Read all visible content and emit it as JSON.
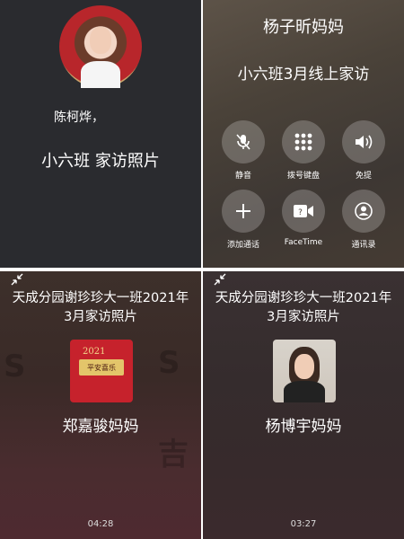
{
  "panel_top_left": {
    "caller_name": "陈柯烨，",
    "subtitle": "小六班 家访照片"
  },
  "panel_top_right": {
    "contact_name": "杨子昕妈妈",
    "call_subtitle": "小六班3月线上家访",
    "controls": [
      {
        "label": "静音",
        "icon": "mute-mic-icon"
      },
      {
        "label": "拨号键盘",
        "icon": "keypad-icon"
      },
      {
        "label": "免提",
        "icon": "speaker-icon"
      },
      {
        "label": "添加通话",
        "icon": "add-call-icon"
      },
      {
        "label": "FaceTime",
        "icon": "facetime-icon"
      },
      {
        "label": "通讯录",
        "icon": "contacts-icon"
      }
    ]
  },
  "panel_bottom_left": {
    "title": "天成分园谢珍珍大一班2021年3月家访照片",
    "thumb_year": "2021",
    "thumb_text": "平安喜乐",
    "contact_name": "郑嘉骏妈妈",
    "timer": "04:28"
  },
  "panel_bottom_right": {
    "title": "天成分园谢珍珍大一班2021年3月家访照片",
    "contact_name": "杨博宇妈妈",
    "timer": "03:27"
  },
  "colors": {
    "dark_bg": "#2a2b2f",
    "control_circle": "rgba(255,255,255,0.22)",
    "thumb_red": "#c6222c"
  }
}
